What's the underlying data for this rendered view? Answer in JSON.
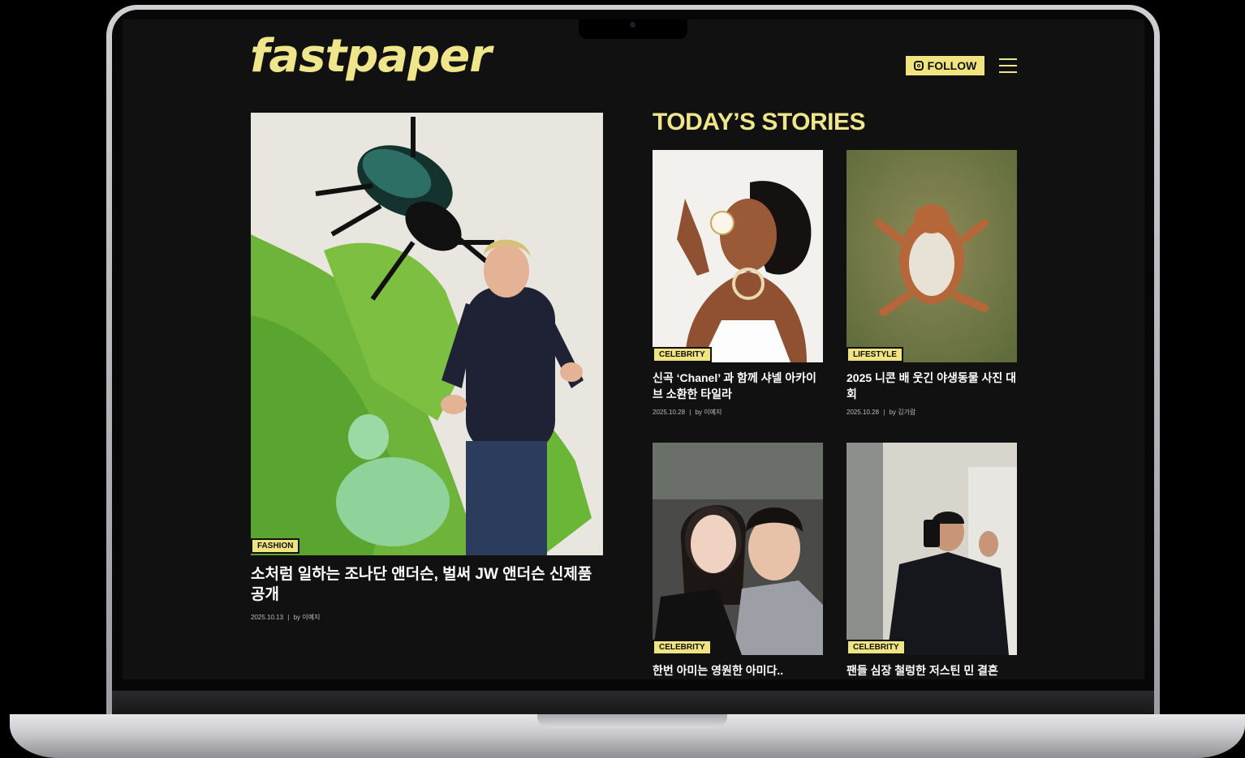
{
  "site": {
    "logo": "fastpaper",
    "follow_label": "FOLLOW"
  },
  "hero": {
    "category": "FASHION",
    "title": "소처럼 일하는 조나단 앤더슨, 벌써 JW 앤더슨 신제품 공개",
    "date": "2025.10.13",
    "author": "by 이예지"
  },
  "section": {
    "title": "TODAY’S STORIES"
  },
  "stories": [
    {
      "category": "CELEBRITY",
      "title": "신곡 ‘Chanel’ 과 함께 샤넬 아카이브 소환한 타일라",
      "date": "2025.10.28",
      "author": "by 이예지"
    },
    {
      "category": "LIFESTYLE",
      "title": "2025 니콘 배 웃긴 야생동물 사진 대회",
      "date": "2025.10.28",
      "author": "by 김가람"
    },
    {
      "category": "CELEBRITY",
      "title": "한번 아미는 영원한 아미다.."
    },
    {
      "category": "CELEBRITY",
      "title": "팬들 심장 철렁한 저스틴 민 결혼"
    }
  ],
  "colors": {
    "accent": "#efe480",
    "background": "#111111",
    "text": "#ffffff"
  }
}
